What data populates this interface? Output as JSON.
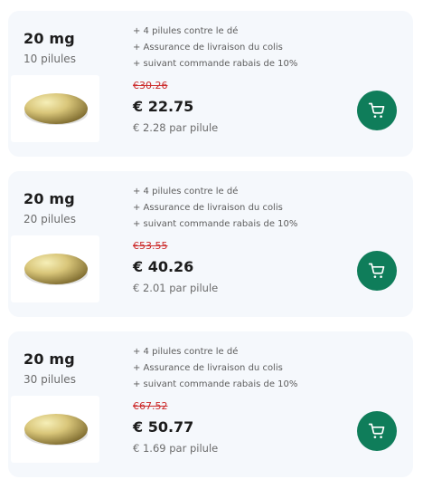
{
  "accent_color": "#0f7d5a",
  "old_price_color": "#cc2b2b",
  "offers": [
    {
      "dose": "20 mg",
      "count": "10 pilules",
      "benefits": [
        "+ 4 pilules contre le dé",
        "+ Assurance de livraison du colis",
        "+ suivant commande rabais de 10%"
      ],
      "old_price": "€30.26",
      "price": "€ 22.75",
      "unit_price": "€ 2.28 par pilule",
      "cart_icon": "shopping-cart-icon"
    },
    {
      "dose": "20 mg",
      "count": "20 pilules",
      "benefits": [
        "+ 4 pilules contre le dé",
        "+ Assurance de livraison du colis",
        "+ suivant commande rabais de 10%"
      ],
      "old_price": "€53.55",
      "price": "€ 40.26",
      "unit_price": "€ 2.01 par pilule",
      "cart_icon": "shopping-cart-icon"
    },
    {
      "dose": "20 mg",
      "count": "30 pilules",
      "benefits": [
        "+ 4 pilules contre le dé",
        "+ Assurance de livraison du colis",
        "+ suivant commande rabais de 10%"
      ],
      "old_price": "€67.52",
      "price": "€ 50.77",
      "unit_price": "€ 1.69 par pilule",
      "cart_icon": "shopping-cart-icon"
    }
  ]
}
